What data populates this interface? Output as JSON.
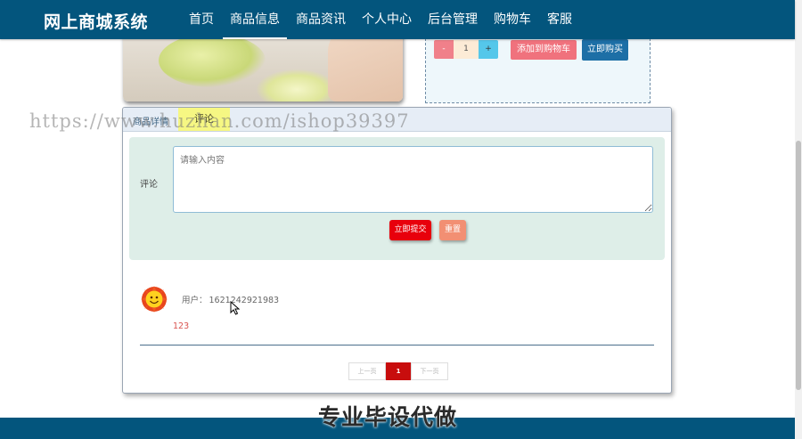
{
  "navbar": {
    "brand": "网上商城系统",
    "items": [
      {
        "label": "首页"
      },
      {
        "label": "商品信息"
      },
      {
        "label": "商品资讯"
      },
      {
        "label": "个人中心"
      },
      {
        "label": "后台管理"
      },
      {
        "label": "购物车"
      },
      {
        "label": "客服"
      }
    ],
    "active_index": 1
  },
  "purchase": {
    "minus_label": "-",
    "quantity": "1",
    "plus_label": "+",
    "add_to_cart_label": "添加到购物车",
    "buy_now_label": "立即购买"
  },
  "tabs": {
    "detail_label": "商品详情",
    "comment_label": "评论"
  },
  "comment_form": {
    "label": "评论",
    "placeholder": "请输入内容",
    "submit_label": "立即提交",
    "reset_label": "重置"
  },
  "comments": [
    {
      "user_label": "用户：",
      "user_id": "1621242921983",
      "content": "123"
    }
  ],
  "pagination": {
    "prev_label": "上一页",
    "current_page": "1",
    "next_label": "下一页"
  },
  "watermark": {
    "url": "https://www.huzhan.com/ishop39397",
    "caption": "专业毕设代做"
  },
  "colors": {
    "nav_bg": "#03557d",
    "add_cart": "#f0727d",
    "buy_now": "#1d6fa6",
    "submit": "#e8000c",
    "reset": "#f28f73",
    "page_active": "#c80d0d"
  }
}
